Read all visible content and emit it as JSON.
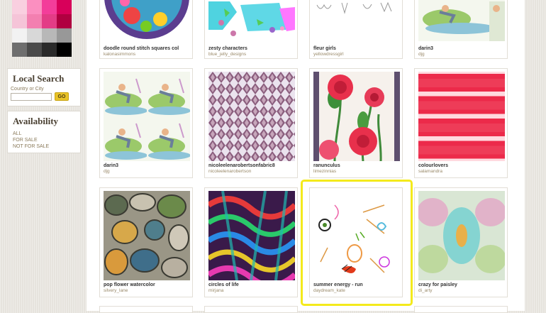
{
  "colors": {
    "accent_go": "#e8c227",
    "highlight": "#f4ea1c",
    "swatches": [
      "#f9cfe0",
      "#fb8fc0",
      "#f33d9a",
      "#d8005a",
      "#f5c4d8",
      "#f37fb0",
      "#e33c86",
      "#b00040",
      "#f2f2f2",
      "#d8d8d8",
      "#b8b8b8",
      "#989898",
      "#6e6e6e",
      "#4a4a4a",
      "#2a2a2a",
      "#000000"
    ]
  },
  "sidebar": {
    "local_search": {
      "title": "Local Search",
      "label": "Country or City",
      "value": "",
      "go_label": "GO"
    },
    "availability": {
      "title": "Availability",
      "options": [
        "ALL",
        "FOR SALE",
        "NOT FOR SALE"
      ]
    }
  },
  "designs": [
    {
      "title": "doodle round stitch squares col",
      "user": "kalonasimmons",
      "icon": "doodle-circles-pattern"
    },
    {
      "title": "zesty characters",
      "user": "blue_jelly_designs",
      "icon": "characters-pattern"
    },
    {
      "title": "fleur girls",
      "user": "yellowdressgirl",
      "icon": "line-drawing-pattern"
    },
    {
      "title": "darin3",
      "user": "djg",
      "icon": "watercolor-figure-pattern"
    },
    {
      "title": "darin3",
      "user": "djg",
      "icon": "watercolor-figure-pattern"
    },
    {
      "title": "nicoleelenarobertsonfabric8",
      "user": "nicoleelenarobertson",
      "icon": "argyle-pattern"
    },
    {
      "title": "ranunculus",
      "user": "limezinnias",
      "icon": "red-flower-pattern"
    },
    {
      "title": "colourlovers",
      "user": "salamandra",
      "icon": "red-stripe-pattern"
    },
    {
      "title": "pop flower watercolor",
      "user": "silvery_lane",
      "icon": "pebble-pattern"
    },
    {
      "title": "circles of life",
      "user": "mirjana",
      "icon": "psychedelic-pattern"
    },
    {
      "title": "summer energy - run",
      "user": "daydream_kate",
      "icon": "abstract-sketch-pattern"
    },
    {
      "title": "crazy for paisley",
      "user": "di_arty",
      "icon": "mirror-paisley-pattern"
    }
  ]
}
